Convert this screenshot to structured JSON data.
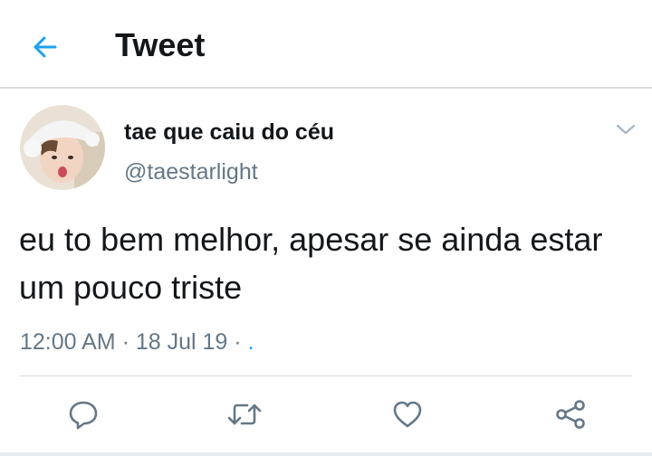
{
  "header": {
    "title": "Tweet",
    "back_icon": "arrow-left-icon"
  },
  "tweet": {
    "display_name": "tae que caiu do céu",
    "handle": "@taestarlight",
    "text": "eu to bem melhor, apesar se ainda estar um pouco triste",
    "time": "12:00 AM",
    "date": "18 Jul 19",
    "source": ".",
    "separator": "·"
  },
  "actions": [
    "reply-icon",
    "retweet-icon",
    "like-icon",
    "share-icon"
  ],
  "colors": {
    "accent": "#1da1f2",
    "text": "#14171a",
    "secondary": "#657786",
    "icon": "#657786",
    "border": "#d6dadd"
  }
}
